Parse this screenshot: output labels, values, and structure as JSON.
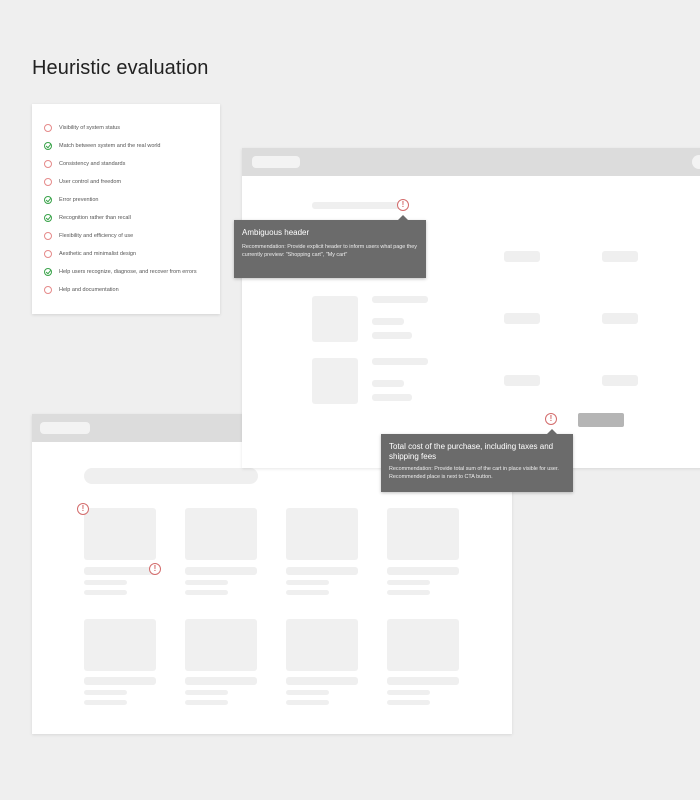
{
  "page": {
    "title": "Heuristic evaluation"
  },
  "heuristics": [
    {
      "label": "Visibility of system status",
      "status": "issue",
      "icon": "warning-circle-icon"
    },
    {
      "label": "Match between system and the real world",
      "status": "pass",
      "icon": "check-circle-icon"
    },
    {
      "label": "Consistency and standards",
      "status": "issue",
      "icon": "warning-circle-icon"
    },
    {
      "label": "User control and freedom",
      "status": "issue",
      "icon": "warning-circle-icon"
    },
    {
      "label": "Error prevention",
      "status": "pass",
      "icon": "check-circle-icon"
    },
    {
      "label": "Recognition rather than recall",
      "status": "pass",
      "icon": "check-circle-icon"
    },
    {
      "label": "Flexibility and efficiency of use",
      "status": "issue",
      "icon": "warning-circle-icon"
    },
    {
      "label": "Aesthetic and minimalist design",
      "status": "issue",
      "icon": "warning-circle-icon"
    },
    {
      "label": "Help users recognize, diagnose, and recover from errors",
      "status": "pass",
      "icon": "check-circle-icon"
    },
    {
      "label": "Help and documentation",
      "status": "issue",
      "icon": "warning-circle-icon"
    }
  ],
  "tooltips": {
    "header": {
      "title": "Ambiguous header",
      "body": "Recommendation: Provide explicit header to inform users what page they currently preview: \"Shopping cart\", \"My cart\""
    },
    "total": {
      "title": "Total cost of the purchase, including taxes and shipping fees",
      "body": "Recommendation: Provide total sum of the cart in place visible for user. Recommended place is next to CTA button."
    }
  },
  "markers": {
    "symbol": "!"
  },
  "colors": {
    "background": "#efefef",
    "issue": "#d36c6c",
    "pass": "#3aa34a",
    "tooltip": "#6b6b6b",
    "window_bar": "#dcdcdc"
  }
}
